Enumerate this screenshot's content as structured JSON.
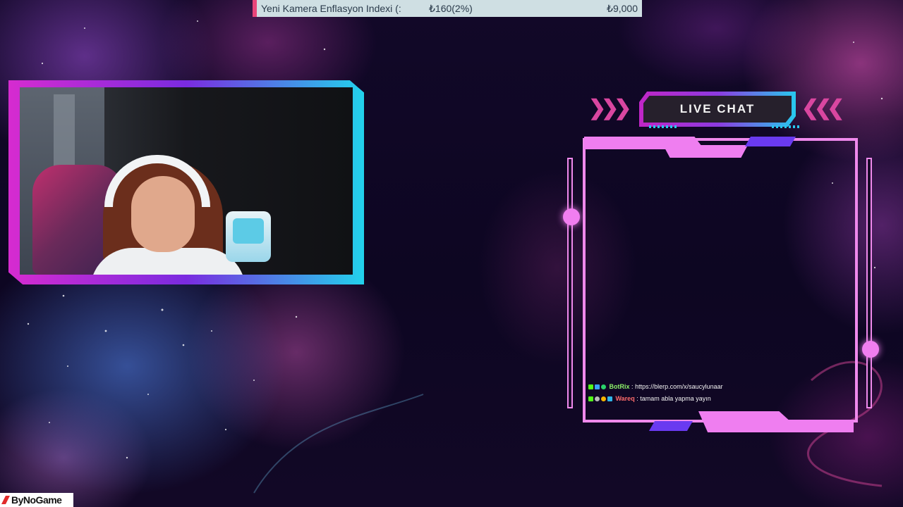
{
  "ticker": {
    "name": "Yeni Kamera Enflasyon Indexi (:",
    "change": "₺160(2%)",
    "value": "₺9,000"
  },
  "live_chat": {
    "title": "LIVE CHAT",
    "messages": [
      {
        "user": "BotRix",
        "separator": ":",
        "text": "https://blerp.com/x/saucylunaar",
        "user_color": "#8ef26a"
      },
      {
        "user": "Wareq",
        "separator": ":",
        "text": "tamam abla yapma yayın",
        "user_color": "#ff6b6b"
      }
    ]
  },
  "webcam": {
    "description_icon": "webcam-feed"
  },
  "logo": {
    "text": "ByNoGame"
  },
  "colors": {
    "accent_pink": "#ef89ec",
    "accent_cyan": "#27c9ee",
    "accent_purple": "#6a3af0",
    "ticker_bg": "#cfdfe3",
    "ticker_marker": "#e8457a"
  }
}
